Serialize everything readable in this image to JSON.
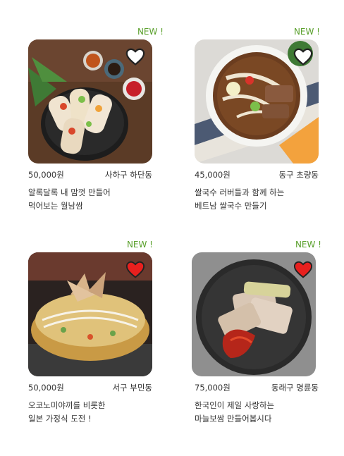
{
  "cards": [
    {
      "badge": "NEW !",
      "photo": "spring-rolls-photo",
      "favorite": false,
      "price": "50,000원",
      "location": "사하구 하단동",
      "description": "알록달록 내 맘껏 만들어\n먹어보는 월남쌈"
    },
    {
      "badge": "NEW !",
      "photo": "pho-noodle-soup-photo",
      "favorite": false,
      "price": "45,000원",
      "location": "동구 초량동",
      "description": "쌀국수 러버들과 함께 하는\n베트남 쌀국수 만들기"
    },
    {
      "badge": "NEW !",
      "photo": "okonomiyaki-photo",
      "favorite": true,
      "price": "50,000원",
      "location": "서구 부민동",
      "description": "오코노미야끼를 비롯한\n일본 가정식 도전 !"
    },
    {
      "badge": "NEW !",
      "photo": "garlic-bossam-photo",
      "favorite": true,
      "price": "75,000원",
      "location": "동래구 명륜동",
      "description": "한국인이 제일 사랑하는\n마늘보쌈 만들어봅시다"
    }
  ],
  "colors": {
    "badge": "#5aa02c",
    "heart_active": "#e8201e",
    "heart_outline": "#222222"
  }
}
